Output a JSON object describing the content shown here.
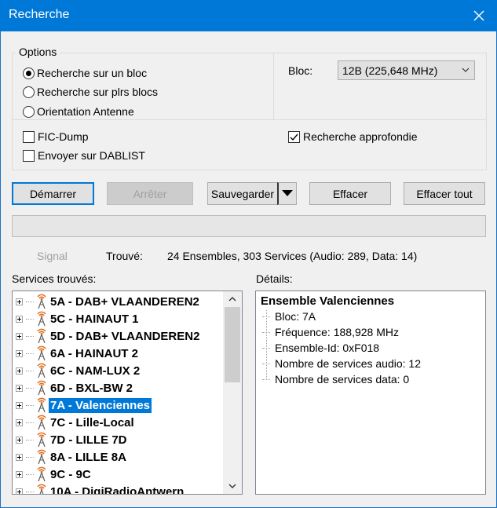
{
  "window": {
    "title": "Recherche"
  },
  "options": {
    "group_label": "Options",
    "search_modes": [
      {
        "label": "Recherche sur un bloc",
        "selected": true
      },
      {
        "label": "Recherche sur plrs blocs",
        "selected": false
      },
      {
        "label": "Orientation Antenne",
        "selected": false
      }
    ],
    "bloc_label": "Bloc:",
    "bloc_value": "12B (225,648 MHz)",
    "fic_dump": {
      "label": "FIC-Dump",
      "checked": false
    },
    "send_dablist": {
      "label": "Envoyer sur DABLIST",
      "checked": false
    },
    "deep_search": {
      "label": "Recherche approfondie",
      "checked": true
    }
  },
  "buttons": {
    "start": "Démarrer",
    "stop": "Arrêter",
    "save": "Sauvegarder",
    "clear": "Effacer",
    "clear_all": "Effacer tout"
  },
  "status": {
    "signal_label": "Signal",
    "found_label": "Trouvé:",
    "found_value": "24 Ensembles, 303 Services (Audio: 289, Data: 14)"
  },
  "services": {
    "label": "Services trouvés:",
    "items": [
      "5A - DAB+ VLAANDEREN2",
      "5C - HAINAUT 1",
      "5D - DAB+ VLAANDEREN2",
      "6A - HAINAUT 2",
      "6C - NAM-LUX 2",
      "6D - BXL-BW 2",
      "7A - Valenciennes",
      "7C - Lille-Local",
      "7D - LILLE 7D",
      "8A - LILLE 8A",
      "9C - 9C",
      "10A - DigiRadioAntwern"
    ],
    "selected_index": 6
  },
  "details": {
    "label": "Détails:",
    "title": "Ensemble Valenciennes",
    "rows": [
      "Bloc: 7A",
      "Fréquence: 188,928 MHz",
      "Ensemble-Id: 0xF018",
      "Nombre de services audio: 12",
      "Nombre de services data: 0"
    ]
  },
  "colors": {
    "titlebar": "#0078d7",
    "selection": "#0078d7",
    "antenna": "#e07020"
  }
}
